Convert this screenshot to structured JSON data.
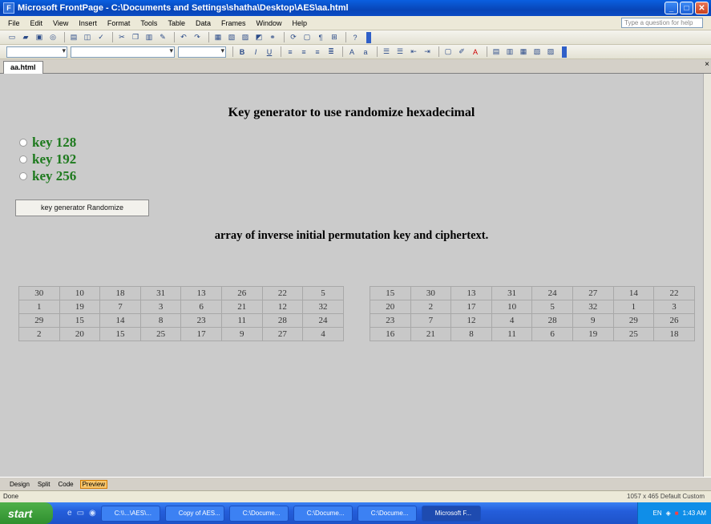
{
  "window": {
    "title": "Microsoft FrontPage - C:\\Documents and Settings\\shatha\\Desktop\\AES\\aa.html"
  },
  "menu": {
    "items": [
      "File",
      "Edit",
      "View",
      "Insert",
      "Format",
      "Tools",
      "Table",
      "Data",
      "Frames",
      "Window",
      "Help"
    ],
    "help_placeholder": "Type a question for help"
  },
  "tabs": {
    "document": "aa.html"
  },
  "page": {
    "heading": "Key generator to use randomize hexadecimal",
    "options": [
      "key 128",
      "key 192",
      "key 256"
    ],
    "button_label": "key generator Randomize",
    "subheading": "array of inverse initial permutation key and ciphertext."
  },
  "table_left": [
    [
      30,
      10,
      18,
      31,
      13,
      26,
      22,
      5
    ],
    [
      1,
      19,
      7,
      3,
      6,
      21,
      12,
      32
    ],
    [
      29,
      15,
      14,
      8,
      23,
      11,
      28,
      24
    ],
    [
      2,
      20,
      15,
      25,
      17,
      9,
      27,
      4
    ]
  ],
  "table_right": [
    [
      15,
      30,
      13,
      31,
      24,
      27,
      14,
      22
    ],
    [
      20,
      2,
      17,
      10,
      5,
      32,
      1,
      3
    ],
    [
      23,
      7,
      12,
      4,
      28,
      9,
      29,
      26
    ],
    [
      16,
      21,
      8,
      11,
      6,
      19,
      25,
      18
    ]
  ],
  "views": {
    "items": [
      "Design",
      "Split",
      "Code",
      "Preview"
    ],
    "active": "Preview"
  },
  "status": {
    "left": "Done",
    "right": "1057 x 465   Default   Custom"
  },
  "taskbar": {
    "start": "start",
    "tasks": [
      "C:\\\\...\\AES\\...",
      "Copy of AES...",
      "C:\\Docume...",
      "C:\\Docume...",
      "C:\\Docume...",
      "Microsoft F..."
    ],
    "tray_lang": "EN",
    "clock": "1:43 AM"
  }
}
